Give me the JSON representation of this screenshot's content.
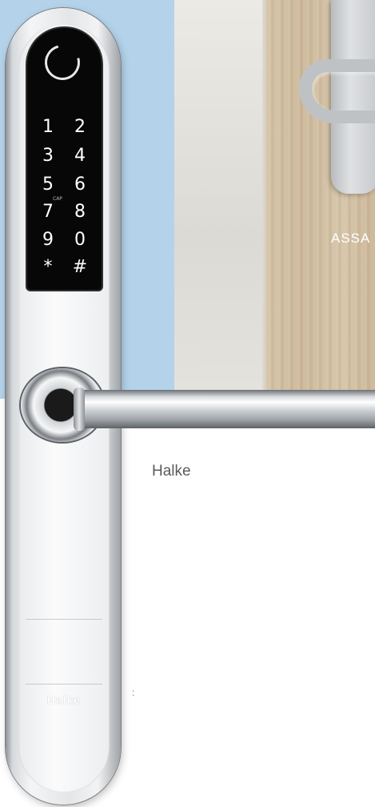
{
  "photo_labels": {
    "assa": "ASSA",
    "caption": "Halke",
    "colon": ":"
  },
  "handle": {
    "brand": "Halke",
    "keypad_cap": "CAP",
    "keys": [
      "1",
      "2",
      "3",
      "4",
      "5",
      "6",
      "7",
      "8",
      "9",
      "0",
      "*",
      "#"
    ]
  },
  "colors": {
    "background_panel": "#b4d3ea",
    "keypad": "#070707"
  }
}
